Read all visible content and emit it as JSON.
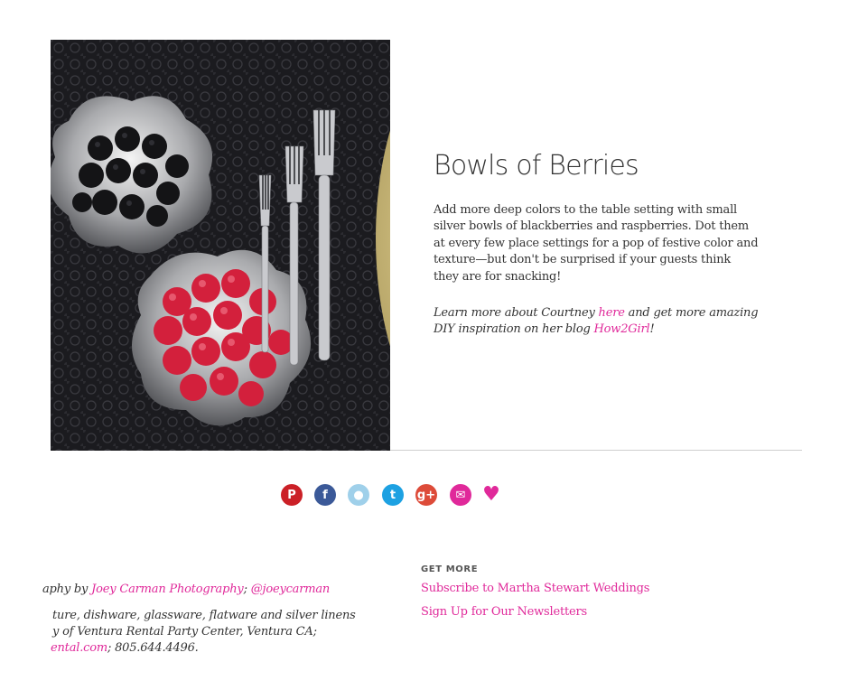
{
  "article": {
    "title": "Bowls of Berries",
    "description": "Add more deep colors to the table setting with small silver bowls of blackberries and raspberries. Dot them at every few place settings for a pop of festive color and texture—but don't be surprised if your guests think they are for snacking!",
    "learn_prefix": "Learn more about Courtney ",
    "learn_link_here": "here",
    "learn_middle": " and get more amazing DIY inspiration on her blog ",
    "learn_link_blog": "How2Girl",
    "learn_suffix": "!"
  },
  "share": {
    "icons": [
      {
        "name": "pinterest-icon",
        "glyph": "P",
        "color": "#cb2027"
      },
      {
        "name": "facebook-icon",
        "glyph": "f",
        "color": "#3b5998"
      },
      {
        "name": "comment-icon",
        "glyph": "●",
        "color": "#9fd0ea"
      },
      {
        "name": "twitter-icon",
        "glyph": "t",
        "color": "#1da1e2"
      },
      {
        "name": "google-plus-icon",
        "glyph": "g+",
        "color": "#dd4b39"
      },
      {
        "name": "email-icon",
        "glyph": "✉",
        "color": "#e0299a"
      },
      {
        "name": "heart-icon",
        "glyph": "♥",
        "color": "#e0299a"
      }
    ]
  },
  "credits": {
    "line1_prefix": "aphy by ",
    "line1_link1": "Joey Carman Photography",
    "line1_sep": "; ",
    "line1_link2": "@joeycarman",
    "line2": "ture, dishware, glassware, flatware and silver linens",
    "line3": "y of Ventura Rental Party Center, Ventura CA;",
    "line4_link": "ental.com",
    "line4_suffix": "; 805.644.4496."
  },
  "get_more": {
    "label": "GET MORE",
    "link1": "Subscribe to Martha Stewart Weddings",
    "link2": "Sign Up for Our Newsletters"
  },
  "colors": {
    "accent": "#e0299a",
    "text": "#333333",
    "divider": "#cfcfcf"
  }
}
